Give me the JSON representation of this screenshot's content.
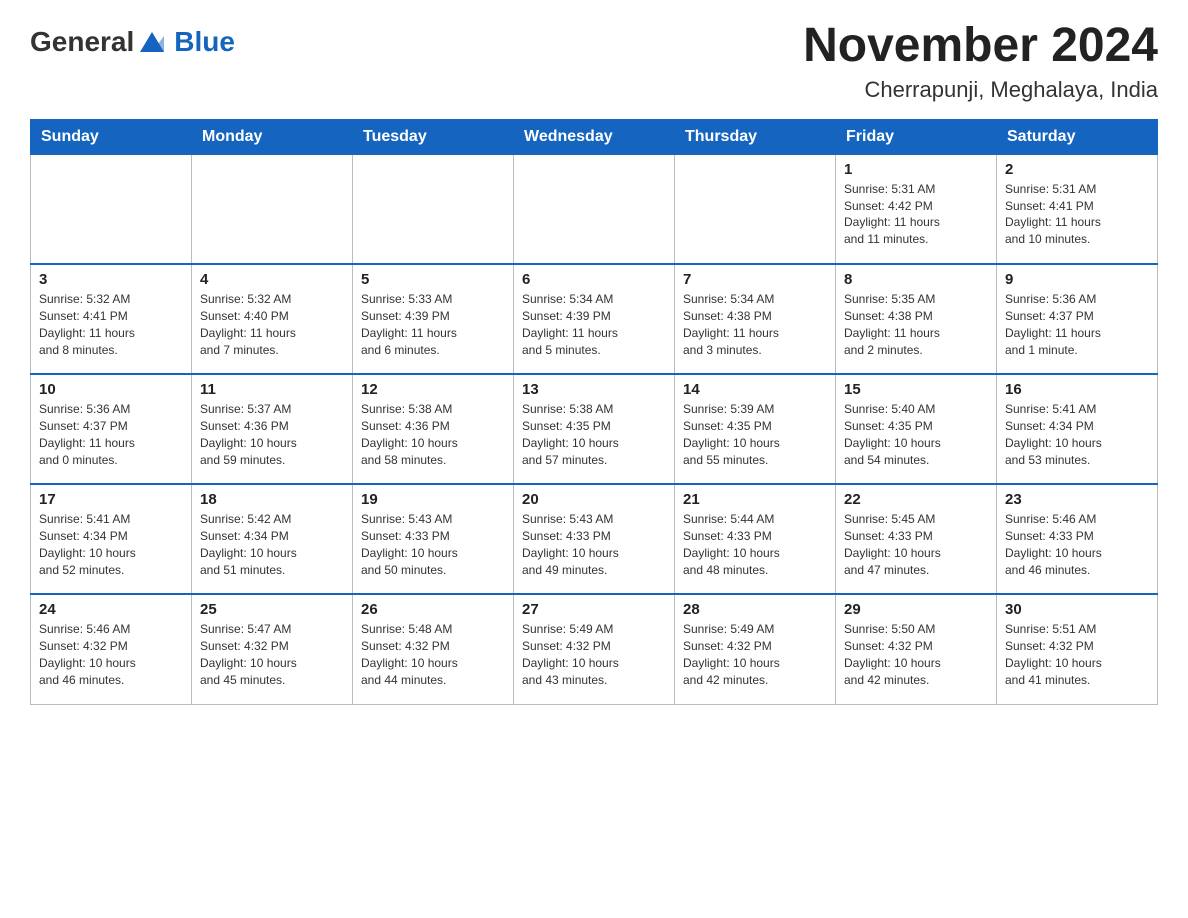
{
  "header": {
    "logo_general": "General",
    "logo_blue": "Blue",
    "title": "November 2024",
    "subtitle": "Cherrapunji, Meghalaya, India"
  },
  "calendar": {
    "days_of_week": [
      "Sunday",
      "Monday",
      "Tuesday",
      "Wednesday",
      "Thursday",
      "Friday",
      "Saturday"
    ],
    "weeks": [
      [
        {
          "day": "",
          "info": ""
        },
        {
          "day": "",
          "info": ""
        },
        {
          "day": "",
          "info": ""
        },
        {
          "day": "",
          "info": ""
        },
        {
          "day": "",
          "info": ""
        },
        {
          "day": "1",
          "info": "Sunrise: 5:31 AM\nSunset: 4:42 PM\nDaylight: 11 hours\nand 11 minutes."
        },
        {
          "day": "2",
          "info": "Sunrise: 5:31 AM\nSunset: 4:41 PM\nDaylight: 11 hours\nand 10 minutes."
        }
      ],
      [
        {
          "day": "3",
          "info": "Sunrise: 5:32 AM\nSunset: 4:41 PM\nDaylight: 11 hours\nand 8 minutes."
        },
        {
          "day": "4",
          "info": "Sunrise: 5:32 AM\nSunset: 4:40 PM\nDaylight: 11 hours\nand 7 minutes."
        },
        {
          "day": "5",
          "info": "Sunrise: 5:33 AM\nSunset: 4:39 PM\nDaylight: 11 hours\nand 6 minutes."
        },
        {
          "day": "6",
          "info": "Sunrise: 5:34 AM\nSunset: 4:39 PM\nDaylight: 11 hours\nand 5 minutes."
        },
        {
          "day": "7",
          "info": "Sunrise: 5:34 AM\nSunset: 4:38 PM\nDaylight: 11 hours\nand 3 minutes."
        },
        {
          "day": "8",
          "info": "Sunrise: 5:35 AM\nSunset: 4:38 PM\nDaylight: 11 hours\nand 2 minutes."
        },
        {
          "day": "9",
          "info": "Sunrise: 5:36 AM\nSunset: 4:37 PM\nDaylight: 11 hours\nand 1 minute."
        }
      ],
      [
        {
          "day": "10",
          "info": "Sunrise: 5:36 AM\nSunset: 4:37 PM\nDaylight: 11 hours\nand 0 minutes."
        },
        {
          "day": "11",
          "info": "Sunrise: 5:37 AM\nSunset: 4:36 PM\nDaylight: 10 hours\nand 59 minutes."
        },
        {
          "day": "12",
          "info": "Sunrise: 5:38 AM\nSunset: 4:36 PM\nDaylight: 10 hours\nand 58 minutes."
        },
        {
          "day": "13",
          "info": "Sunrise: 5:38 AM\nSunset: 4:35 PM\nDaylight: 10 hours\nand 57 minutes."
        },
        {
          "day": "14",
          "info": "Sunrise: 5:39 AM\nSunset: 4:35 PM\nDaylight: 10 hours\nand 55 minutes."
        },
        {
          "day": "15",
          "info": "Sunrise: 5:40 AM\nSunset: 4:35 PM\nDaylight: 10 hours\nand 54 minutes."
        },
        {
          "day": "16",
          "info": "Sunrise: 5:41 AM\nSunset: 4:34 PM\nDaylight: 10 hours\nand 53 minutes."
        }
      ],
      [
        {
          "day": "17",
          "info": "Sunrise: 5:41 AM\nSunset: 4:34 PM\nDaylight: 10 hours\nand 52 minutes."
        },
        {
          "day": "18",
          "info": "Sunrise: 5:42 AM\nSunset: 4:34 PM\nDaylight: 10 hours\nand 51 minutes."
        },
        {
          "day": "19",
          "info": "Sunrise: 5:43 AM\nSunset: 4:33 PM\nDaylight: 10 hours\nand 50 minutes."
        },
        {
          "day": "20",
          "info": "Sunrise: 5:43 AM\nSunset: 4:33 PM\nDaylight: 10 hours\nand 49 minutes."
        },
        {
          "day": "21",
          "info": "Sunrise: 5:44 AM\nSunset: 4:33 PM\nDaylight: 10 hours\nand 48 minutes."
        },
        {
          "day": "22",
          "info": "Sunrise: 5:45 AM\nSunset: 4:33 PM\nDaylight: 10 hours\nand 47 minutes."
        },
        {
          "day": "23",
          "info": "Sunrise: 5:46 AM\nSunset: 4:33 PM\nDaylight: 10 hours\nand 46 minutes."
        }
      ],
      [
        {
          "day": "24",
          "info": "Sunrise: 5:46 AM\nSunset: 4:32 PM\nDaylight: 10 hours\nand 46 minutes."
        },
        {
          "day": "25",
          "info": "Sunrise: 5:47 AM\nSunset: 4:32 PM\nDaylight: 10 hours\nand 45 minutes."
        },
        {
          "day": "26",
          "info": "Sunrise: 5:48 AM\nSunset: 4:32 PM\nDaylight: 10 hours\nand 44 minutes."
        },
        {
          "day": "27",
          "info": "Sunrise: 5:49 AM\nSunset: 4:32 PM\nDaylight: 10 hours\nand 43 minutes."
        },
        {
          "day": "28",
          "info": "Sunrise: 5:49 AM\nSunset: 4:32 PM\nDaylight: 10 hours\nand 42 minutes."
        },
        {
          "day": "29",
          "info": "Sunrise: 5:50 AM\nSunset: 4:32 PM\nDaylight: 10 hours\nand 42 minutes."
        },
        {
          "day": "30",
          "info": "Sunrise: 5:51 AM\nSunset: 4:32 PM\nDaylight: 10 hours\nand 41 minutes."
        }
      ]
    ]
  }
}
